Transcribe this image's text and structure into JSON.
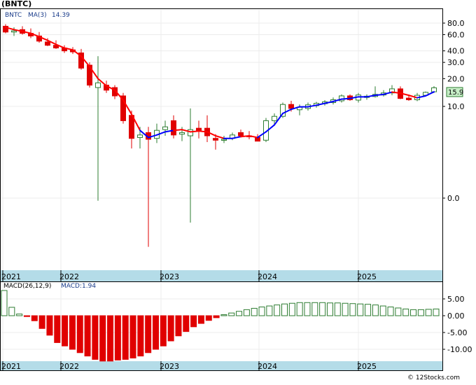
{
  "title": "(BNTC)",
  "legend": {
    "symbol": "BNTC",
    "ma_label": "MA(3)",
    "ma_value": "14.39"
  },
  "last_price_label": "15.9",
  "macd_label": {
    "name": "MACD(26,12,9)",
    "value_text": "MACD:1.94"
  },
  "watermark": "© 12Stocks.com",
  "colors": {
    "up": "#2e7d32",
    "down": "#e00000",
    "ma_down": "#ff0000",
    "ma_up": "#0000ff",
    "axis_band": "#b4dce8",
    "price_box": "#c8f0c8"
  },
  "chart_data": [
    {
      "type": "candlestick",
      "title": "(BNTC)",
      "scale": "log",
      "y_ticks": [
        "80.0",
        "60.0",
        "40.0",
        "30.0",
        "20.0",
        "10.0",
        "0.0"
      ],
      "x_labels": [
        "2021",
        "2022",
        "2023",
        "2024",
        "2025"
      ],
      "ylim_visible": [
        0.18,
        100
      ],
      "candles": [
        {
          "o": 74,
          "h": 78,
          "l": 62,
          "c": 64
        },
        {
          "o": 64,
          "h": 72,
          "l": 58,
          "c": 66
        },
        {
          "o": 68,
          "h": 74,
          "l": 60,
          "c": 62
        },
        {
          "o": 62,
          "h": 70,
          "l": 55,
          "c": 58
        },
        {
          "o": 58,
          "h": 64,
          "l": 49,
          "c": 51
        },
        {
          "o": 50,
          "h": 55,
          "l": 45,
          "c": 46
        },
        {
          "o": 46,
          "h": 52,
          "l": 42,
          "c": 43
        },
        {
          "o": 43,
          "h": 46,
          "l": 38,
          "c": 40
        },
        {
          "o": 41,
          "h": 44,
          "l": 37,
          "c": 39
        },
        {
          "o": 38,
          "h": 42,
          "l": 25,
          "c": 26
        },
        {
          "o": 28,
          "h": 30,
          "l": 16,
          "c": 17
        },
        {
          "o": 16,
          "h": 35,
          "l": 0.95,
          "c": 18
        },
        {
          "o": 17,
          "h": 19,
          "l": 14,
          "c": 15
        },
        {
          "o": 16,
          "h": 17,
          "l": 12,
          "c": 13
        },
        {
          "o": 13,
          "h": 14,
          "l": 6.5,
          "c": 7
        },
        {
          "o": 8,
          "h": 9,
          "l": 3.5,
          "c": 4.5
        },
        {
          "o": 4.6,
          "h": 6,
          "l": 3.5,
          "c": 4.9
        },
        {
          "o": 5.2,
          "h": 6,
          "l": 0.3,
          "c": 4.4
        },
        {
          "o": 4.5,
          "h": 6.5,
          "l": 4,
          "c": 5.5
        },
        {
          "o": 5.6,
          "h": 7,
          "l": 4.8,
          "c": 6
        },
        {
          "o": 7,
          "h": 8,
          "l": 4.5,
          "c": 4.9
        },
        {
          "o": 5,
          "h": 6,
          "l": 4.2,
          "c": 5.2
        },
        {
          "o": 4.8,
          "h": 9.5,
          "l": 0.55,
          "c": 5.6
        },
        {
          "o": 5.8,
          "h": 7,
          "l": 4.5,
          "c": 5.4
        },
        {
          "o": 5.8,
          "h": 8,
          "l": 4.1,
          "c": 4.8
        },
        {
          "o": 4.5,
          "h": 5,
          "l": 3.4,
          "c": 4.3
        },
        {
          "o": 4.3,
          "h": 4.8,
          "l": 4,
          "c": 4.4
        },
        {
          "o": 4.5,
          "h": 5.2,
          "l": 4.3,
          "c": 4.9
        },
        {
          "o": 5.2,
          "h": 5.6,
          "l": 4.6,
          "c": 4.8
        },
        {
          "o": 4.8,
          "h": 5.4,
          "l": 4.4,
          "c": 4.7
        },
        {
          "o": 4.6,
          "h": 5,
          "l": 4.2,
          "c": 4.2
        },
        {
          "o": 4.3,
          "h": 7.5,
          "l": 4.1,
          "c": 7
        },
        {
          "o": 7,
          "h": 8.4,
          "l": 6.3,
          "c": 7.8
        },
        {
          "o": 7.8,
          "h": 11,
          "l": 7.5,
          "c": 10.5
        },
        {
          "o": 10.5,
          "h": 11.5,
          "l": 8.8,
          "c": 9.5
        },
        {
          "o": 9.2,
          "h": 10.5,
          "l": 8,
          "c": 9.8
        },
        {
          "o": 9.5,
          "h": 11,
          "l": 9,
          "c": 10.4
        },
        {
          "o": 10.2,
          "h": 11.2,
          "l": 9.7,
          "c": 10.8
        },
        {
          "o": 10.7,
          "h": 11.7,
          "l": 10.2,
          "c": 11.2
        },
        {
          "o": 11,
          "h": 12.5,
          "l": 10.5,
          "c": 11.8
        },
        {
          "o": 11.5,
          "h": 13.5,
          "l": 11,
          "c": 13
        },
        {
          "o": 13,
          "h": 13.5,
          "l": 11.5,
          "c": 11.8
        },
        {
          "o": 11.7,
          "h": 14,
          "l": 11,
          "c": 13.3
        },
        {
          "o": 12.5,
          "h": 13.5,
          "l": 11.8,
          "c": 12.9
        },
        {
          "o": 12.8,
          "h": 16.5,
          "l": 12.5,
          "c": 13.5
        },
        {
          "o": 13.3,
          "h": 15,
          "l": 12.8,
          "c": 14
        },
        {
          "o": 14,
          "h": 17,
          "l": 13.2,
          "c": 15.5
        },
        {
          "o": 15.5,
          "h": 16.5,
          "l": 12,
          "c": 12.2
        },
        {
          "o": 12.3,
          "h": 13,
          "l": 11.5,
          "c": 11.8
        },
        {
          "o": 11.8,
          "h": 14,
          "l": 11.4,
          "c": 13.2
        },
        {
          "o": 13.2,
          "h": 14.5,
          "l": 12.8,
          "c": 14.2
        },
        {
          "o": 14.4,
          "h": 16.6,
          "l": 14,
          "c": 15.9
        }
      ],
      "ma": [
        {
          "y": 72,
          "trend": "down"
        },
        {
          "y": 68,
          "trend": "down"
        },
        {
          "y": 65,
          "trend": "down"
        },
        {
          "y": 62,
          "trend": "down"
        },
        {
          "y": 57,
          "trend": "down"
        },
        {
          "y": 52,
          "trend": "down"
        },
        {
          "y": 47,
          "trend": "down"
        },
        {
          "y": 43,
          "trend": "down"
        },
        {
          "y": 41,
          "trend": "down"
        },
        {
          "y": 35,
          "trend": "down"
        },
        {
          "y": 27,
          "trend": "down"
        },
        {
          "y": 20,
          "trend": "down"
        },
        {
          "y": 16.7,
          "trend": "down"
        },
        {
          "y": 15,
          "trend": "down"
        },
        {
          "y": 11.7,
          "trend": "down"
        },
        {
          "y": 8.2,
          "trend": "down"
        },
        {
          "y": 5.5,
          "trend": "down"
        },
        {
          "y": 4.6,
          "trend": "up"
        },
        {
          "y": 4.9,
          "trend": "up"
        },
        {
          "y": 5.3,
          "trend": "up"
        },
        {
          "y": 5.5,
          "trend": "up"
        },
        {
          "y": 5.6,
          "trend": "down"
        },
        {
          "y": 5.3,
          "trend": "down"
        },
        {
          "y": 5.4,
          "trend": "down"
        },
        {
          "y": 5.3,
          "trend": "down"
        },
        {
          "y": 4.8,
          "trend": "down"
        },
        {
          "y": 4.5,
          "trend": "down"
        },
        {
          "y": 4.5,
          "trend": "up"
        },
        {
          "y": 4.7,
          "trend": "up"
        },
        {
          "y": 4.8,
          "trend": "down"
        },
        {
          "y": 4.6,
          "trend": "down"
        },
        {
          "y": 5.3,
          "trend": "up"
        },
        {
          "y": 6.3,
          "trend": "up"
        },
        {
          "y": 8.4,
          "trend": "up"
        },
        {
          "y": 9.3,
          "trend": "up"
        },
        {
          "y": 9.9,
          "trend": "up"
        },
        {
          "y": 9.9,
          "trend": "up"
        },
        {
          "y": 10.3,
          "trend": "up"
        },
        {
          "y": 10.8,
          "trend": "up"
        },
        {
          "y": 11.3,
          "trend": "up"
        },
        {
          "y": 12,
          "trend": "up"
        },
        {
          "y": 12.2,
          "trend": "up"
        },
        {
          "y": 12.7,
          "trend": "up"
        },
        {
          "y": 12.7,
          "trend": "up"
        },
        {
          "y": 13.2,
          "trend": "up"
        },
        {
          "y": 13.5,
          "trend": "up"
        },
        {
          "y": 14.3,
          "trend": "up"
        },
        {
          "y": 13.9,
          "trend": "down"
        },
        {
          "y": 13.2,
          "trend": "down"
        },
        {
          "y": 12.4,
          "trend": "down"
        },
        {
          "y": 13,
          "trend": "up"
        },
        {
          "y": 14.39,
          "trend": "up"
        }
      ]
    },
    {
      "type": "bar",
      "title": "MACD(26,12,9)",
      "y_ticks": [
        "5.00",
        "0.00",
        "-5.00",
        "-10.00"
      ],
      "x_labels": [
        "2021",
        "2022",
        "2023",
        "2024",
        "2025"
      ],
      "ylim_visible": [
        -13.3,
        7.6
      ],
      "values": [
        7.5,
        2.5,
        0.5,
        -0.2,
        -1.5,
        -3.8,
        -5.8,
        -8,
        -9,
        -10,
        -11,
        -12,
        -13,
        -13.5,
        -13.5,
        -13.2,
        -13,
        -12.6,
        -12,
        -11,
        -10,
        -9,
        -7.5,
        -6,
        -4.7,
        -3.3,
        -2.3,
        -1.4,
        -0.6,
        0.3,
        0.8,
        1.3,
        1.8,
        2.2,
        2.6,
        2.9,
        3.2,
        3.5,
        3.7,
        3.9,
        3.9,
        3.9,
        3.9,
        3.8,
        3.8,
        3.7,
        3.6,
        3.5,
        3.4,
        3.2,
        2.9,
        2.6,
        2.3,
        2,
        1.8,
        1.8,
        1.9,
        2.0
      ]
    }
  ]
}
